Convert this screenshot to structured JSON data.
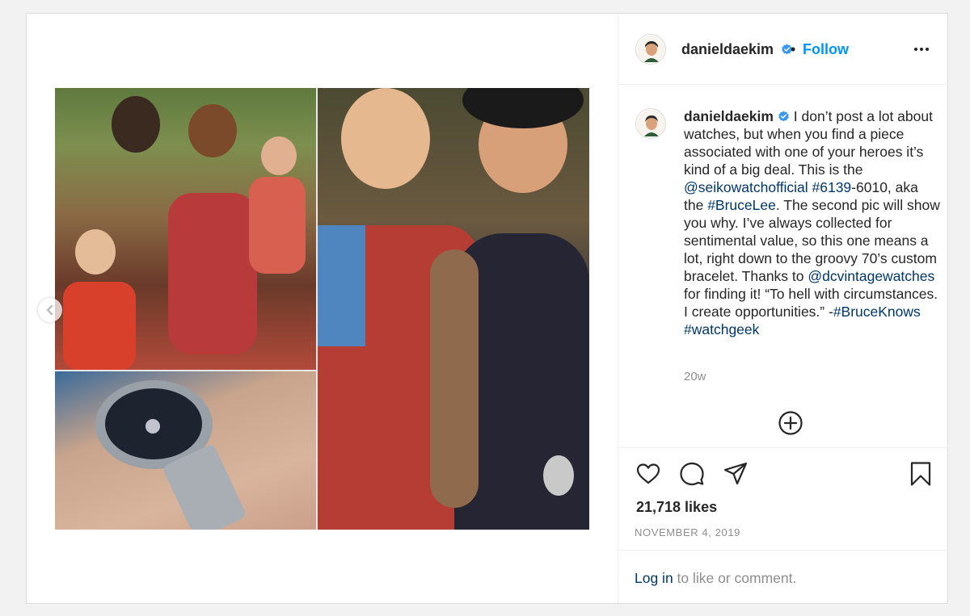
{
  "post": {
    "username": "danieldaekim",
    "follow_label": "Follow",
    "separator": "•",
    "caption": {
      "username": "danieldaekim",
      "text_1": "I don’t post a lot about watches, but when you find a piece associated with one of your heroes it’s kind of a big deal. This is the ",
      "mention_1": "@seikowatchofficial",
      "space_1": " ",
      "hashtag_1": "#6139",
      "text_2": "-6010, aka the ",
      "hashtag_2": "#BruceLee",
      "text_3": ". The second pic will show you why. I’ve always collected for sentimental value, so this one means a lot, right down to the groovy 70’s custom bracelet. Thanks to ",
      "mention_2": "@dcvintagewatches",
      "text_4": " for finding it! “To hell with circumstances. I create opportunities.” -",
      "hashtag_3": "#BruceKnows",
      "hashtag_4": "#watchgeek"
    },
    "time_ago": "20w",
    "likes": "21,718 likes",
    "date": "NOVEMBER 4, 2019",
    "login": {
      "link": "Log in",
      "rest": " to like or comment."
    }
  },
  "icons": {
    "verified": "verified-badge-icon",
    "more": "more-options-icon",
    "add": "add-comment-icon",
    "like": "heart-icon",
    "comment": "comment-icon",
    "share": "share-icon",
    "save": "bookmark-icon",
    "prev": "chevron-left-icon"
  },
  "colors": {
    "link_blue": "#0095f6",
    "tag_blue": "#00376b",
    "muted": "#8e8e8e",
    "verified_blue": "#3897f0"
  }
}
